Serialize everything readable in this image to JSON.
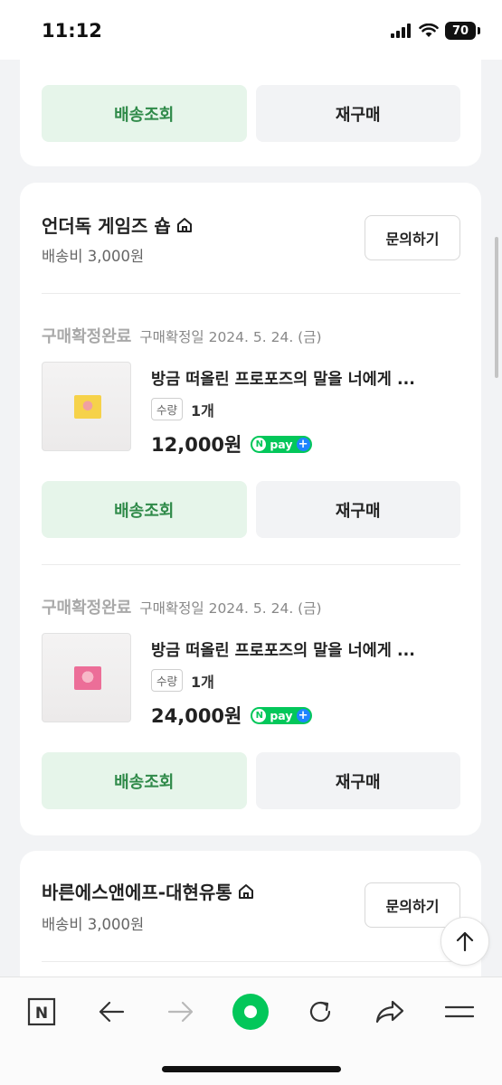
{
  "status_bar": {
    "time": "11:12",
    "battery": "70"
  },
  "top_card": {
    "track_label": "배송조회",
    "rebuy_label": "재구매"
  },
  "stores": [
    {
      "name": "언더독 게임즈 숍",
      "shipping_fee": "배송비 3,000원",
      "inquiry_label": "문의하기",
      "orders": [
        {
          "status": "구매확정완료",
          "confirm_date": "구매확정일 2024. 5. 24. (금)",
          "title": "방금 떠올린 프로포즈의 말을 너에게 ...",
          "qty_label": "수량",
          "qty": "1개",
          "price": "12,000원",
          "thumb_color": "#f6d24a",
          "track_label": "배송조회",
          "rebuy_label": "재구매"
        },
        {
          "status": "구매확정완료",
          "confirm_date": "구매확정일 2024. 5. 24. (금)",
          "title": "방금 떠올린 프로포즈의 말을 너에게 ...",
          "qty_label": "수량",
          "qty": "1개",
          "price": "24,000원",
          "thumb_color": "#ec6e98",
          "track_label": "배송조회",
          "rebuy_label": "재구매"
        }
      ]
    },
    {
      "name": "바른에스앤에프-대현유통",
      "shipping_fee": "배송비 3,000원",
      "inquiry_label": "문의하기"
    }
  ],
  "npay": {
    "n": "N",
    "text": "pay",
    "plus": "+"
  },
  "toolbar": {
    "n_label": "N"
  },
  "icons": [
    "home-store-icon",
    "scroll-top-icon",
    "naver-n-icon",
    "back-arrow-icon",
    "forward-arrow-icon",
    "green-dot-icon",
    "refresh-icon",
    "share-icon",
    "menu-icon"
  ],
  "colors": {
    "accent_green": "#2f8a49",
    "green_button_bg": "#e6f5ea",
    "npay_green": "#03c75a",
    "npay_plus_blue": "#1e84ff"
  }
}
